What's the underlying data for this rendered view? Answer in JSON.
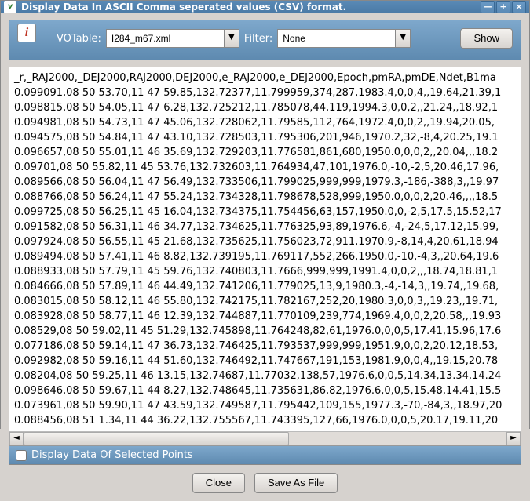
{
  "window": {
    "title": "Display Data In ASCII Comma seperated values (CSV) format.",
    "min_icon": "—",
    "max_icon": "+",
    "close_icon": "×"
  },
  "toolbar": {
    "votable_label": "VOTable:",
    "votable_value": "I284_m67.xml",
    "filter_label": "Filter:",
    "filter_value": "None",
    "show_label": "Show"
  },
  "data": {
    "lines": [
      "_r,_RAJ2000,_DEJ2000,RAJ2000,DEJ2000,e_RAJ2000,e_DEJ2000,Epoch,pmRA,pmDE,Ndet,B1ma",
      "0.099091,08 50 53.70,11 47 59.85,132.72377,11.799959,374,287,1983.4,0,0,4,,19.64,21.39,1",
      "0.098815,08 50 54.05,11 47 6.28,132.725212,11.785078,44,119,1994.3,0,0,2,,21.24,,18.92,1",
      "0.094981,08 50 54.73,11 47 45.06,132.728062,11.79585,112,764,1972.4,0,0,2,,19.94,20.05,",
      "0.094575,08 50 54.84,11 47 43.10,132.728503,11.795306,201,946,1970.2,32,-8,4,20.25,19.1",
      "0.096657,08 50 55.01,11 46 35.69,132.729203,11.776581,861,680,1950.0,0,0,2,,20.04,,,18.2",
      "0.09701,08 50 55.82,11 45 53.76,132.732603,11.764934,47,101,1976.0,-10,-2,5,20.46,17.96,",
      "0.089566,08 50 56.04,11 47 56.49,132.733506,11.799025,999,999,1979.3,-186,-388,3,,19.97",
      "0.088766,08 50 56.24,11 47 55.24,132.734328,11.798678,528,999,1950.0,0,0,2,20.46,,,,18.5",
      "0.099725,08 50 56.25,11 45 16.04,132.734375,11.754456,63,157,1950.0,0,-2,5,17.5,15.52,17",
      "0.091582,08 50 56.31,11 46 34.77,132.734625,11.776325,93,89,1976.6,-4,-24,5,17.12,15.99,",
      "0.097924,08 50 56.55,11 45 21.68,132.735625,11.756023,72,911,1970.9,-8,14,4,20.61,18.94",
      "0.089494,08 50 57.41,11 46 8.82,132.739195,11.769117,552,266,1950.0,-10,-4,3,,20.64,19.6",
      "0.088933,08 50 57.79,11 45 59.76,132.740803,11.7666,999,999,1991.4,0,0,2,,,18.74,18.81,1",
      "0.084666,08 50 57.89,11 46 44.49,132.741206,11.779025,13,9,1980.3,-4,-14,3,,19.74,,19.68,",
      "0.083015,08 50 58.12,11 46 55.80,132.742175,11.782167,252,20,1980.3,0,0,3,,19.23,,19.71,",
      "0.083928,08 50 58.77,11 46 12.39,132.744887,11.770109,239,774,1969.4,0,0,2,20.58,,,19.93",
      "0.08529,08 50 59.02,11 45 51.29,132.745898,11.764248,82,61,1976.0,0,0,5,17.41,15.96,17.6",
      "0.077186,08 50 59.14,11 47 36.73,132.746425,11.793537,999,999,1951.9,0,0,2,20.12,18.53,",
      "0.092982,08 50 59.16,11 44 51.60,132.746492,11.747667,191,153,1981.9,0,0,4,,19.15,20.78",
      "0.08204,08 50 59.25,11 46 13.15,132.74687,11.77032,138,57,1976.6,0,0,5,14.34,13.34,14.24",
      "0.098646,08 50 59.67,11 44 8.27,132.748645,11.735631,86,82,1976.6,0,0,5,15.48,14.41,15.5",
      "0.073961,08 50 59.90,11 47 43.59,132.749587,11.795442,109,155,1977.3,-70,-84,3,,18.97,20",
      "0.088456,08 51 1.34,11 44 36.22,132.755567,11.743395,127,66,1976.0,0,0,5,20.17,19.11,20"
    ]
  },
  "checkbox": {
    "label": "Display Data Of Selected Points",
    "checked": false
  },
  "buttons": {
    "close": "Close",
    "save": "Save As File"
  }
}
